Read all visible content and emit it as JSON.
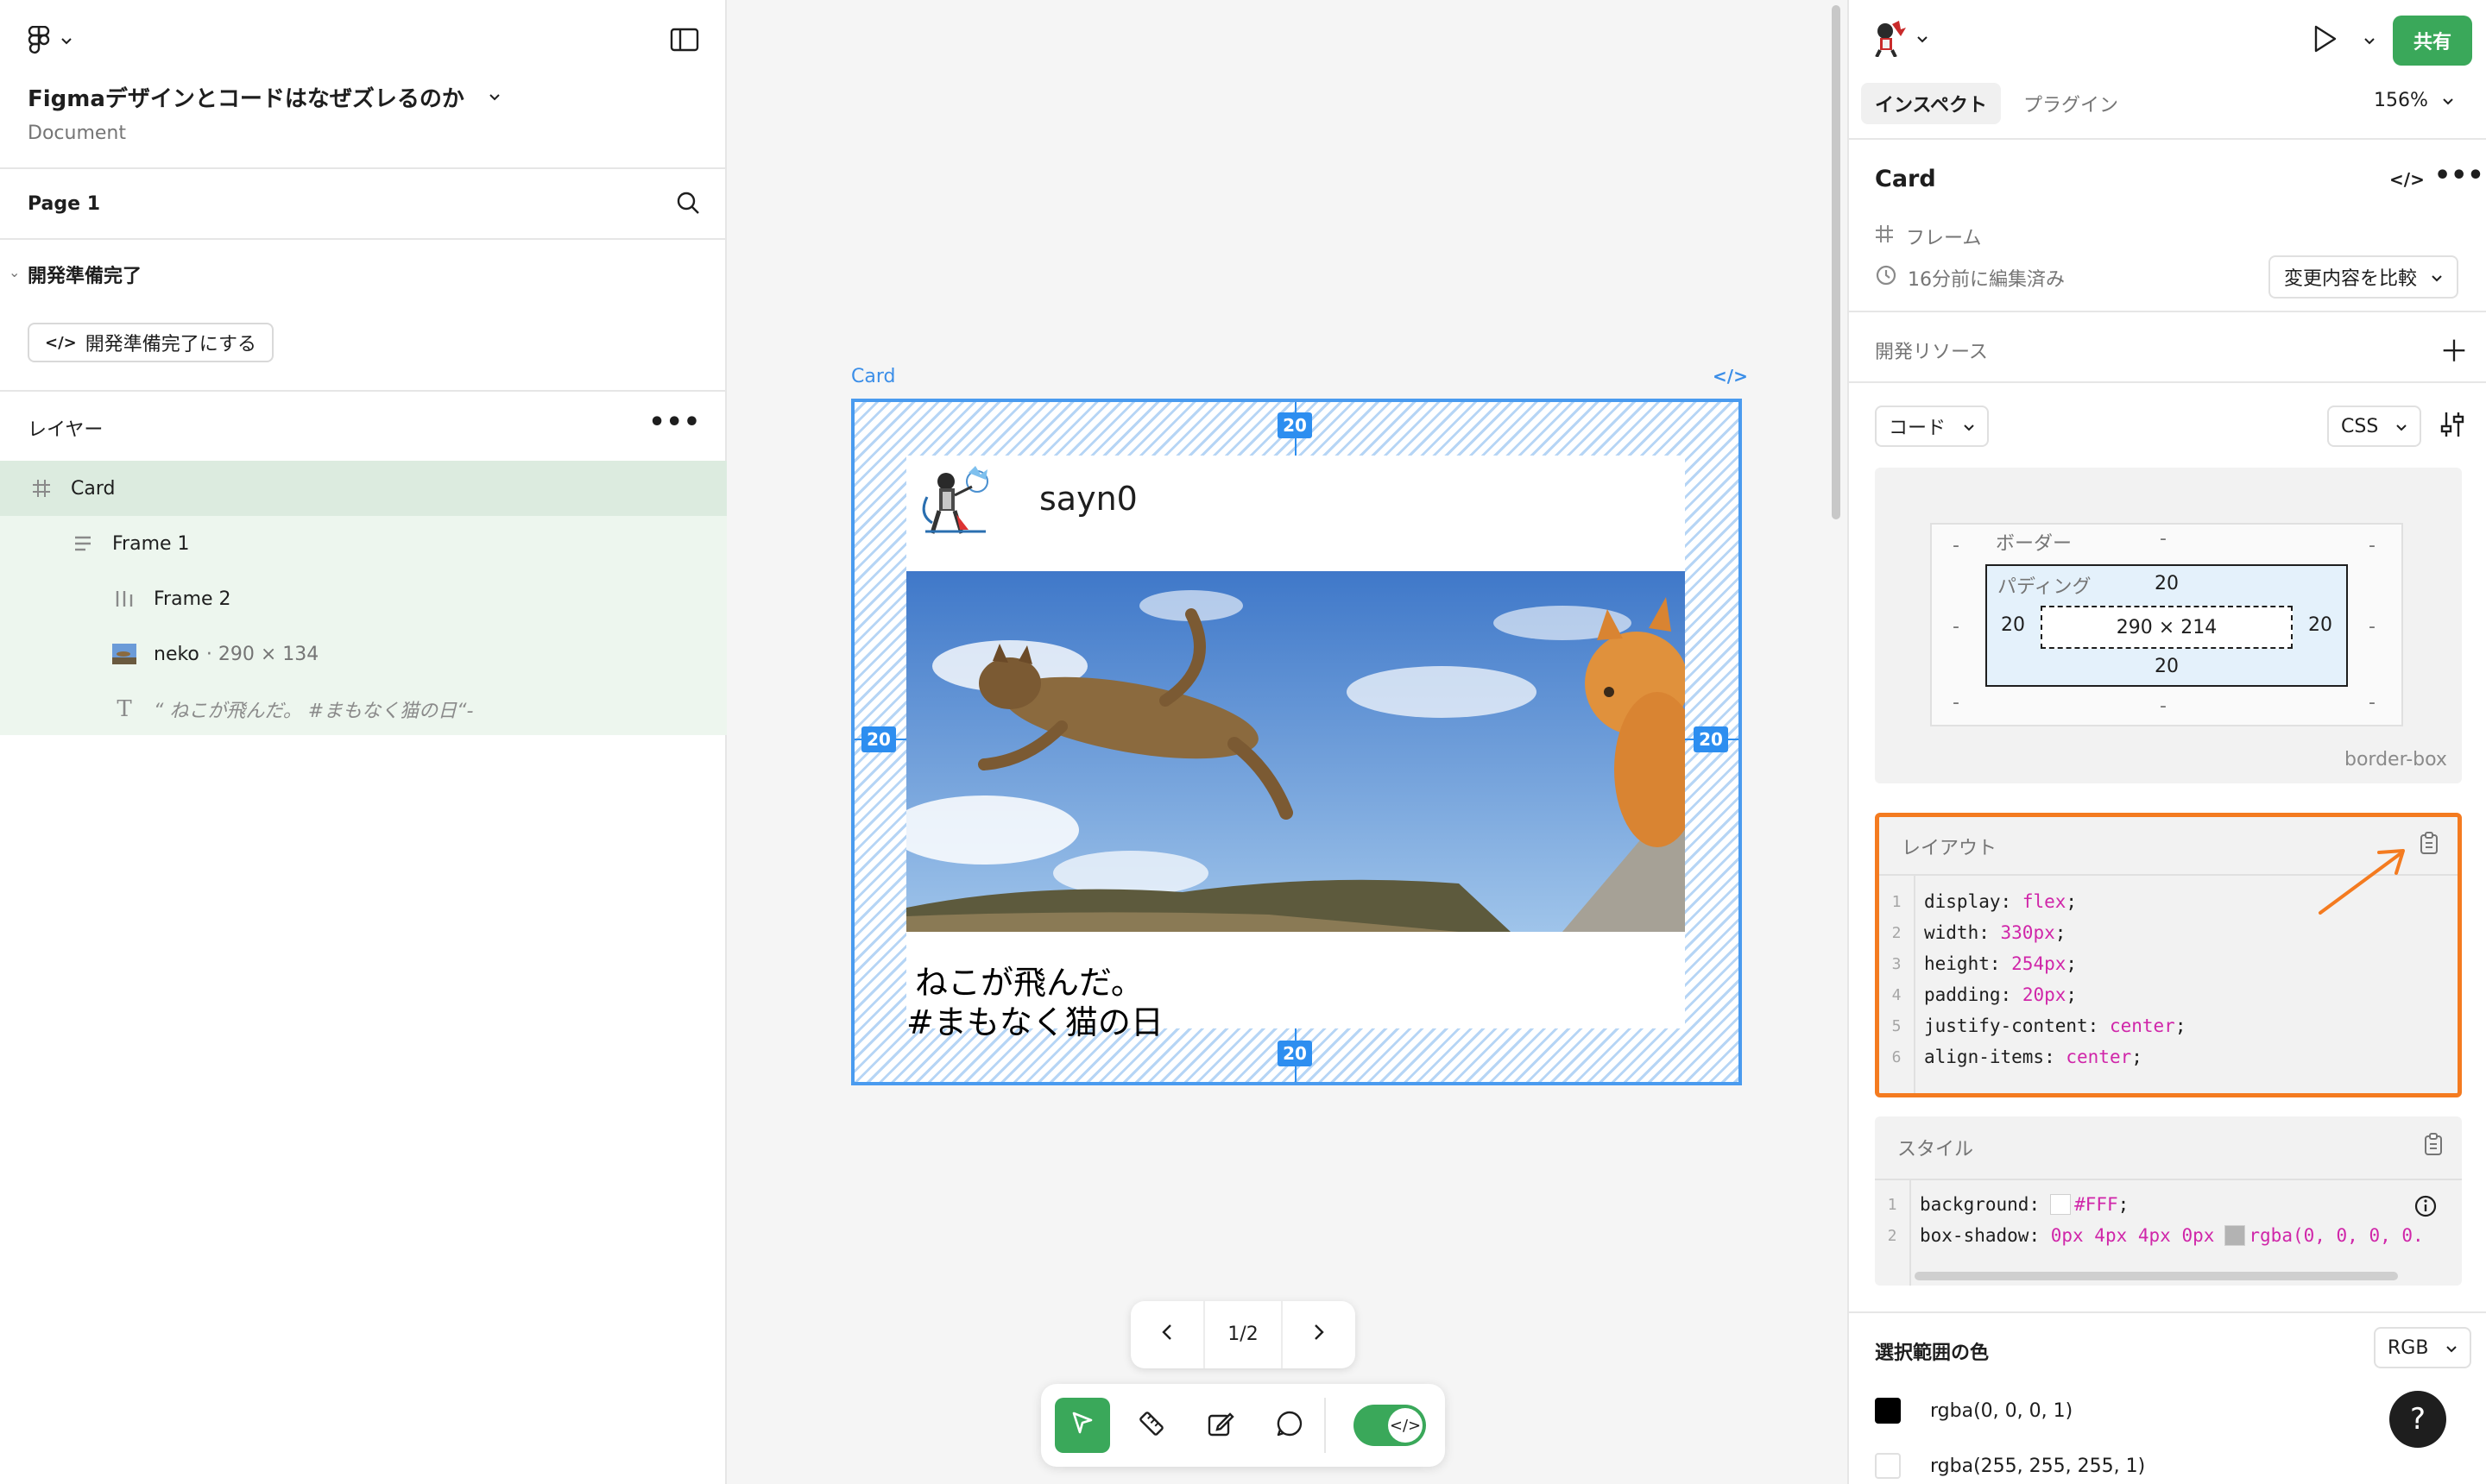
{
  "file": {
    "title": "Figmaデザインとコードはなぜズレるのか",
    "subtitle": "Document"
  },
  "pages": {
    "current": "Page 1"
  },
  "ready_section": {
    "title": "開発準備完了",
    "button_label": "開発準備完了にする"
  },
  "layers": {
    "title": "レイヤー",
    "items": [
      {
        "name": "Card",
        "icon": "frame-hash-icon"
      },
      {
        "name": "Frame 1",
        "icon": "vertical-stack-icon"
      },
      {
        "name": "Frame 2",
        "icon": "horizontal-stack-icon"
      },
      {
        "name": "neko",
        "dim": "· 290 × 134",
        "icon": "image-thumbnail-icon"
      },
      {
        "name": "“ ねこが飛んだ。 #まもなく猫の日“-",
        "icon": "text-icon"
      }
    ]
  },
  "canvas": {
    "frame_label": "Card",
    "username": "sayn0",
    "caption_line1": "ねこが飛んだ。",
    "caption_line2": "#まもなく猫の日",
    "padding_badges": [
      "20",
      "20",
      "20",
      "20"
    ],
    "pager": "1/2"
  },
  "right_panel": {
    "share_label": "共有",
    "tabs": [
      "インスペクト",
      "プラグイン"
    ],
    "zoom": "156%",
    "selection_name": "Card",
    "selection_type": "フレーム",
    "edited": "16分前に編集済み",
    "compare_button": "変更内容を比較",
    "dev_resources": "開発リソース",
    "code_dropdown": "コード",
    "lang_dropdown": "CSS",
    "box_model": {
      "border_label": "ボーダー",
      "padding_label": "パディング",
      "border_dash": "-",
      "padding_top": "20",
      "padding_bottom": "20",
      "padding_left": "20",
      "padding_right": "20",
      "content": "290 × 214",
      "sizing": "border-box"
    },
    "layout_block": {
      "title": "レイアウト",
      "lines": [
        {
          "n": "1",
          "prop": "display",
          "val": "flex"
        },
        {
          "n": "2",
          "prop": "width",
          "val": "330px"
        },
        {
          "n": "3",
          "prop": "height",
          "val": "254px"
        },
        {
          "n": "4",
          "prop": "padding",
          "val": "20px"
        },
        {
          "n": "5",
          "prop": "justify-content",
          "val": "center"
        },
        {
          "n": "6",
          "prop": "align-items",
          "val": "center"
        }
      ]
    },
    "style_block": {
      "title": "スタイル",
      "lines": [
        {
          "n": "1",
          "prop": "background",
          "val": "#FFF"
        },
        {
          "n": "2",
          "prop": "box-shadow",
          "val": "0px 4px 4px 0px",
          "val2": "rgba(0, 0, 0, 0."
        }
      ]
    },
    "selection_colors": {
      "title": "選択範囲の色",
      "mode": "RGB",
      "items": [
        {
          "value": "rgba(0, 0, 0, 1)",
          "color": "#000000"
        },
        {
          "value": "rgba(255, 255, 255, 1)",
          "color": "#FFFFFF"
        }
      ]
    },
    "help": "?"
  },
  "colors": {
    "accent_green": "#3aa85a",
    "selection_blue": "#2d8ef0",
    "highlight_orange": "#f47b20",
    "code_value_pink": "#d026a9"
  }
}
